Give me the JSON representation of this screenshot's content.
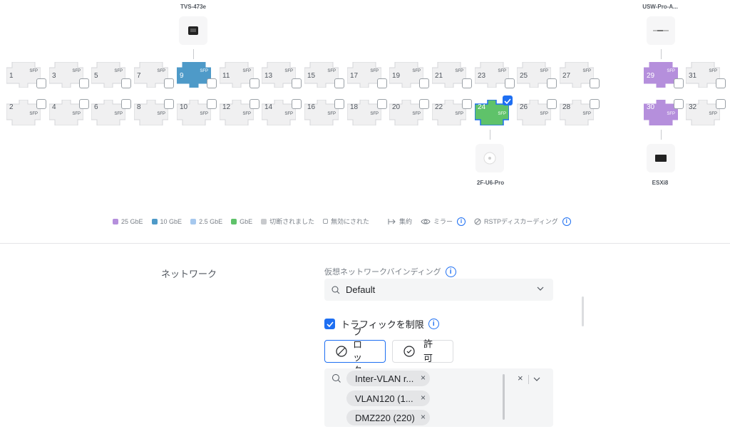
{
  "devices": {
    "nas": {
      "name": "TVS-473e"
    },
    "switch": {
      "name": "USW-Pro-A..."
    },
    "ap": {
      "name": "2F-U6-Pro"
    },
    "host": {
      "name": "ESXi8"
    }
  },
  "ports": {
    "sfp_label": "SFP",
    "top_row": [
      "1",
      "3",
      "5",
      "7",
      "9",
      "11",
      "13",
      "15",
      "17",
      "19",
      "21",
      "23",
      "25",
      "27"
    ],
    "bottom_row": [
      "2",
      "4",
      "6",
      "8",
      "10",
      "12",
      "14",
      "16",
      "18",
      "20",
      "22",
      "24",
      "26",
      "28"
    ],
    "sfp_top": [
      "29",
      "31"
    ],
    "sfp_bottom": [
      "30",
      "32"
    ],
    "states": {
      "9": "10 GbE",
      "24": "GbE (selected)",
      "29": "25 GbE",
      "30": "25 GbE"
    }
  },
  "legend": {
    "items": [
      {
        "label": "25 GbE",
        "color": "#b58fdc"
      },
      {
        "label": "10 GbE",
        "color": "#4e9ac8"
      },
      {
        "label": "2.5 GbE",
        "color": "#a6c8ee"
      },
      {
        "label": "GbE",
        "color": "#5fc26a"
      },
      {
        "label": "切断されました",
        "color": "#c8cacd"
      },
      {
        "label": "無効にされた",
        "color": "#ffffff"
      }
    ],
    "aggregate": "集約",
    "mirror": "ミラー",
    "rstp": "RSTPディスカーディング",
    "info": "i"
  },
  "network": {
    "section_title": "ネットワーク",
    "binding_label": "仮想ネットワークバインディング",
    "binding_value": "Default",
    "restrict_label": "トラフィックを制限",
    "block_label": "ブロック",
    "allow_label": "許可",
    "chips": [
      "Inter-VLAN r...",
      "VLAN120 (1...",
      "DMZ220 (220)"
    ]
  },
  "colors": {
    "accent": "#1e6ff2",
    "gbe": "#5fc26a",
    "ten_gbe": "#4e9ac8",
    "twentyfive_gbe": "#b58fdc"
  }
}
